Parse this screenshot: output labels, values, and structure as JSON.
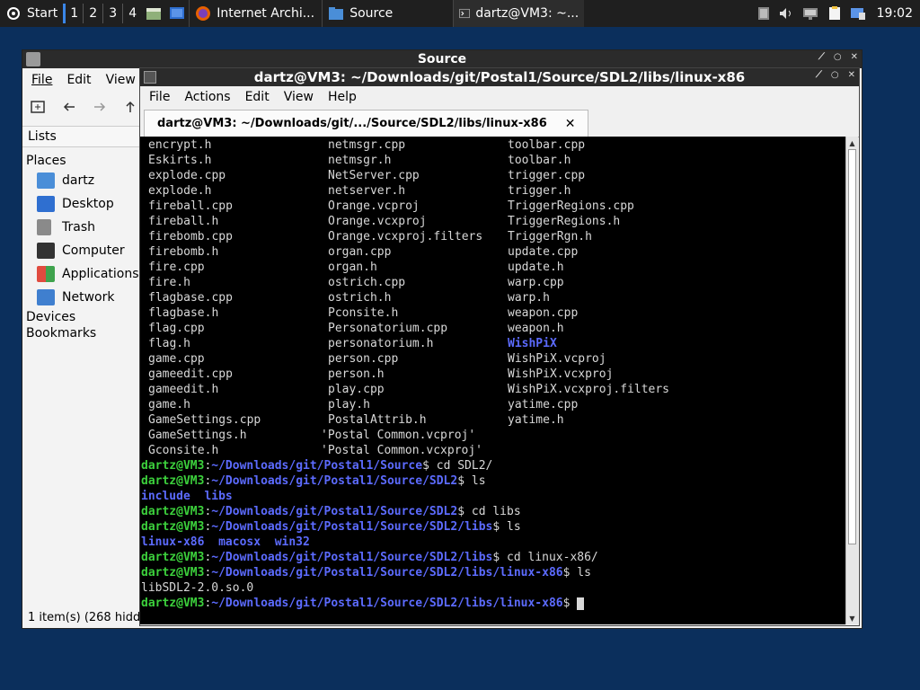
{
  "panel": {
    "start_label": "Start",
    "workspaces": [
      "1",
      "2",
      "3",
      "4"
    ],
    "tasks": [
      {
        "label": "Internet Archi...",
        "icon": "firefox-icon"
      },
      {
        "label": "Source",
        "icon": "folder-icon"
      },
      {
        "label": "dartz@VM3: ~...",
        "icon": "terminal-icon"
      }
    ],
    "clock": "19:02"
  },
  "file_manager": {
    "title": "Source",
    "menu": [
      "File",
      "Edit",
      "View"
    ],
    "lists_label": "Lists",
    "places_heading": "Places",
    "places": [
      "dartz",
      "Desktop",
      "Trash",
      "Computer",
      "Applications",
      "Network"
    ],
    "devices_heading": "Devices",
    "bookmarks_heading": "Bookmarks",
    "status": "1 item(s) (268 hidd"
  },
  "terminal": {
    "title": "dartz@VM3: ~/Downloads/git/Postal1/Source/SDL2/libs/linux-x86",
    "menu": [
      "File",
      "Actions",
      "Edit",
      "View",
      "Help"
    ],
    "tab_label": "dartz@VM3: ~/Downloads/git/.../Source/SDL2/libs/linux-x86",
    "tab_close": "✕",
    "ls_columns": [
      [
        "encrypt.h",
        "Eskirts.h",
        "explode.cpp",
        "explode.h",
        "fireball.cpp",
        "fireball.h",
        "firebomb.cpp",
        "firebomb.h",
        "fire.cpp",
        "fire.h",
        "flagbase.cpp",
        "flagbase.h",
        "flag.cpp",
        "flag.h",
        "game.cpp",
        "gameedit.cpp",
        "gameedit.h",
        "game.h",
        "GameSettings.cpp",
        "GameSettings.h",
        "Gconsite.h"
      ],
      [
        "netmsgr.cpp",
        "netmsgr.h",
        "NetServer.cpp",
        "netserver.h",
        "Orange.vcproj",
        "Orange.vcxproj",
        "Orange.vcxproj.filters",
        "organ.cpp",
        "organ.h",
        "ostrich.cpp",
        "ostrich.h",
        "Pconsite.h",
        "Personatorium.cpp",
        "personatorium.h",
        "person.cpp",
        "person.h",
        "play.cpp",
        "play.h",
        "PostalAttrib.h",
        "'Postal Common.vcproj'",
        "'Postal Common.vcxproj'"
      ],
      [
        "toolbar.cpp",
        "toolbar.h",
        "trigger.cpp",
        "trigger.h",
        "TriggerRegions.cpp",
        "TriggerRegions.h",
        "TriggerRgn.h",
        "update.cpp",
        "update.h",
        "warp.cpp",
        "warp.h",
        "weapon.cpp",
        "weapon.h",
        "WishPiX",
        "WishPiX.vcproj",
        "WishPiX.vcxproj",
        "WishPiX.vcxproj.filters",
        "yatime.cpp",
        "yatime.h",
        "",
        ""
      ]
    ],
    "user_host": "dartz@VM3",
    "session": [
      {
        "type": "prompt",
        "path": "~/Downloads/git/Postal1/Source",
        "cmd": " cd SDL2/"
      },
      {
        "type": "prompt",
        "path": "~/Downloads/git/Postal1/Source/SDL2",
        "cmd": " ls"
      },
      {
        "type": "dirs",
        "text": "include  libs"
      },
      {
        "type": "prompt",
        "path": "~/Downloads/git/Postal1/Source/SDL2",
        "cmd": " cd libs"
      },
      {
        "type": "prompt",
        "path": "~/Downloads/git/Postal1/Source/SDL2/libs",
        "cmd": " ls"
      },
      {
        "type": "dirs",
        "text": "linux-x86  macosx  win32"
      },
      {
        "type": "prompt",
        "path": "~/Downloads/git/Postal1/Source/SDL2/libs",
        "cmd": " cd linux-x86/"
      },
      {
        "type": "prompt",
        "path": "~/Downloads/git/Postal1/Source/SDL2/libs/linux-x86",
        "cmd": " ls"
      },
      {
        "type": "plain",
        "text": "libSDL2-2.0.so.0"
      },
      {
        "type": "prompt_active",
        "path": "~/Downloads/git/Postal1/Source/SDL2/libs/linux-x86",
        "cmd": " "
      }
    ],
    "colors": {
      "user": "#3cd03c",
      "path": "#5c6bff",
      "text": "#d8d8d8",
      "bg": "#000000"
    }
  }
}
